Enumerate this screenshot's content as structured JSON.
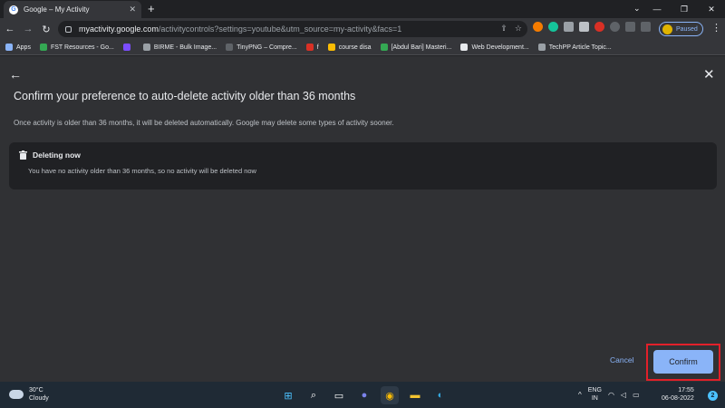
{
  "browser": {
    "tab_title": "Google – My Activity",
    "tab_favicon": "G",
    "new_tab": "+",
    "url_host": "myactivity.google.com",
    "url_path": "/activitycontrols?settings=youtube&utm_source=my-activity&facs=1",
    "profile_status": "Paused",
    "bookmarks": [
      {
        "label": "Apps",
        "color": "#8ab4f8"
      },
      {
        "label": "FST Resources - Go...",
        "color": "#34a853"
      },
      {
        "label": "",
        "color": "#7c4dff"
      },
      {
        "label": "BIRME - Bulk Image...",
        "color": "#9aa0a6"
      },
      {
        "label": "TinyPNG – Compre...",
        "color": "#5f6368"
      },
      {
        "label": "f",
        "color": "#d93025"
      },
      {
        "label": "course disa",
        "color": "#fbbc04"
      },
      {
        "label": "[Abdul Bari] Masteri...",
        "color": "#34a853"
      },
      {
        "label": "Web Development...",
        "color": "#e8eaed"
      },
      {
        "label": "TechPP Article Topic...",
        "color": "#9aa0a6"
      }
    ]
  },
  "dialog": {
    "title": "Confirm your preference to auto-delete activity older than 36 months",
    "description": "Once activity is older than 36 months, it will be deleted automatically. Google may delete some types of activity sooner.",
    "card_title": "Deleting now",
    "card_text": "You have no activity older than 36 months, so no activity will be deleted now",
    "cancel_label": "Cancel",
    "confirm_label": "Confirm"
  },
  "taskbar": {
    "temperature": "30°C",
    "condition": "Cloudy",
    "lang_top": "ENG",
    "lang_bottom": "IN",
    "time": "17:55",
    "date": "06-08-2022",
    "notification_count": "2"
  },
  "colors": {
    "accent": "#8ab4f8",
    "highlight": "#e2202a",
    "surface": "#303134",
    "card": "#202124"
  }
}
